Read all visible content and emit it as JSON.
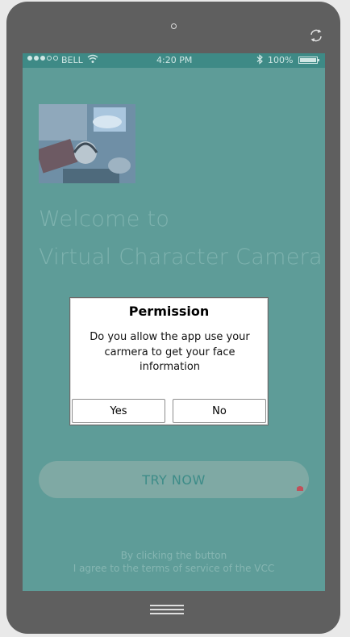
{
  "status_bar": {
    "carrier": "BELL",
    "time": "4:20 PM",
    "battery": "100%"
  },
  "welcome": {
    "line1": "Welcome to",
    "line2": "Virtual Character Camera"
  },
  "cta": {
    "label": "TRY NOW"
  },
  "terms": {
    "line1": "By clicking the button",
    "line2": "I agree to the terms of service of the VCC"
  },
  "dialog": {
    "title": "Permission",
    "message": "Do you allow the app use your carmera to get your face information",
    "yes_label": "Yes",
    "no_label": "No"
  },
  "colors": {
    "screen_overlay": "#5e9c98",
    "status_bar": "#3e8a86",
    "device_frame": "#5f5f5f"
  }
}
